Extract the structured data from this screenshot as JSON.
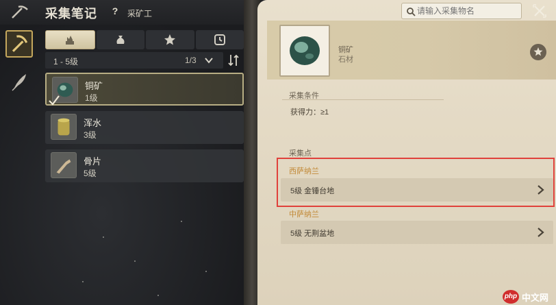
{
  "header": {
    "title": "采集笔记",
    "help": "?",
    "subtitle": "采矿工"
  },
  "tools": [
    {
      "icon": "pickaxe-icon",
      "active": true
    },
    {
      "icon": "feather-icon",
      "active": false
    }
  ],
  "tabs": [
    {
      "icon": "mining-icon",
      "active": true
    },
    {
      "icon": "bag-icon",
      "active": false
    },
    {
      "icon": "star-icon",
      "active": false
    },
    {
      "icon": "clock-icon",
      "active": false
    }
  ],
  "filter": {
    "range": "1 - 5级",
    "page": "1/3"
  },
  "items": [
    {
      "name": "铜矿",
      "level": "1级",
      "selected": true,
      "icon": "copper-ore-icon"
    },
    {
      "name": "浑水",
      "level": "3级",
      "selected": false,
      "icon": "muddy-water-icon"
    },
    {
      "name": "骨片",
      "level": "5级",
      "selected": false,
      "icon": "bone-fragment-icon"
    }
  ],
  "search": {
    "placeholder": "请输入采集物名"
  },
  "detail": {
    "name": "铜矿",
    "type": "石材",
    "condition_title": "采集条件",
    "condition": "获得力：≥1",
    "points_title": "采集点",
    "regions": [
      {
        "name": "西萨纳兰",
        "locations": [
          {
            "text": "5级   金锤台地"
          }
        ]
      },
      {
        "name": "中萨纳兰",
        "locations": [
          {
            "text": "5级   无荆盆地"
          }
        ]
      }
    ]
  },
  "watermark": {
    "logo": "php",
    "text": "中文网"
  },
  "colors": {
    "accent_gold": "#c6a85d",
    "region_orange": "#c28a38",
    "highlight_red": "#e0413b",
    "page_bg": "#e4dac5"
  }
}
